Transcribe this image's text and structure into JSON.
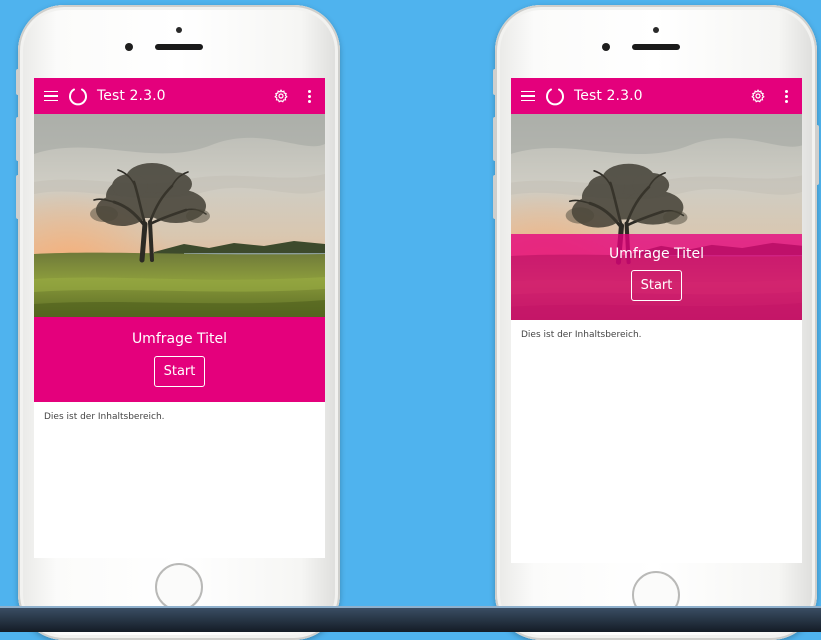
{
  "colors": {
    "background": "#4fb3ee",
    "accent": "#e4007c"
  },
  "phones": [
    {
      "app_title": "Test 2.3.0",
      "survey_title": "Umfrage Titel",
      "start_label": "Start",
      "content_text": "Dies ist der Inhaltsbereich.",
      "icons": [
        "menu-icon",
        "app-logo-icon",
        "gear-icon",
        "more-vert-icon"
      ]
    },
    {
      "app_title": "Test 2.3.0",
      "survey_title": "Umfrage Titel",
      "start_label": "Start",
      "content_text": "Dies ist der Inhaltsbereich.",
      "icons": [
        "menu-icon",
        "app-logo-icon",
        "gear-icon",
        "more-vert-icon"
      ]
    }
  ]
}
